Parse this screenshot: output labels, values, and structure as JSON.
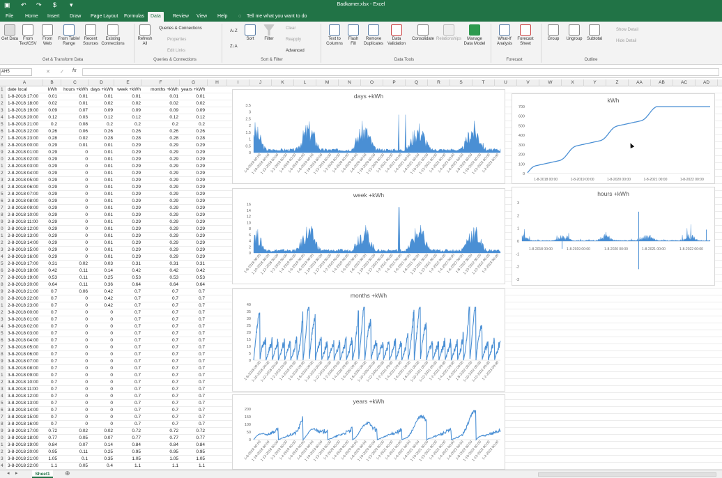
{
  "window": {
    "title": "Badkamer.xlsx  -  Excel"
  },
  "tabs": [
    "File",
    "Home",
    "Insert",
    "Draw",
    "Page Layout",
    "Formulas",
    "Data",
    "Review",
    "View",
    "Help"
  ],
  "tellme": "Tell me what you want to do",
  "ribbon": {
    "get_data": "Get Data",
    "from_text": "From Text/CSV",
    "from_web": "From Web",
    "from_table": "From Table/ Range",
    "recent": "Recent Sources",
    "existing": "Existing Connections",
    "group_get": "Get & Transform Data",
    "refresh": "Refresh All",
    "queries": "Queries & Connections",
    "properties": "Properties",
    "edit_links": "Edit Links",
    "group_queries": "Queries & Connections",
    "sort_az": "A↓Z",
    "sort_za": "Z↓A",
    "sort": "Sort",
    "filter": "Filter",
    "clear": "Clear",
    "reapply": "Reapply",
    "advanced": "Advanced",
    "group_sort": "Sort & Filter",
    "text_cols": "Text to Columns",
    "flash": "Flash Fill",
    "remove_dup": "Remove Duplicates",
    "validation": "Data Validation",
    "consolidate": "Consolidate",
    "relationships": "Relationships",
    "manage_model": "Manage Data Model",
    "group_tools": "Data Tools",
    "whatif": "What-If Analysis",
    "forecast_sheet": "Forecast Sheet",
    "group_forecast": "Forecast",
    "group_btn": "Group",
    "ungroup": "Ungroup",
    "subtotal": "Subtotal",
    "show_detail": "Show Detail",
    "hide_detail": "Hide Detail",
    "group_outline": "Outline"
  },
  "formula": {
    "namebox": "AH5",
    "fx": "fx",
    "cancel": "✕",
    "enter": "✓"
  },
  "columns": [
    "A",
    "B",
    "C",
    "D",
    "E",
    "F",
    "G",
    "H",
    "I",
    "J",
    "K",
    "L",
    "M",
    "N",
    "O",
    "P",
    "Q",
    "R",
    "S",
    "T",
    "U",
    "V",
    "W",
    "X",
    "Y",
    "Z",
    "AA",
    "AB",
    "AC",
    "AD"
  ],
  "headers": [
    "date local",
    "kWh",
    "hours +kWh",
    "days +kWh",
    "week +kWh",
    "months +kWh",
    "years +kWh"
  ],
  "rows": [
    [
      "1",
      "1-8-2018 17:00",
      "0.01",
      "0.01",
      "0.01",
      "0.01",
      "0.01",
      "0.01"
    ],
    [
      "2",
      "1-8-2018 18:00",
      "0.02",
      "0.01",
      "0.02",
      "0.02",
      "0.02",
      "0.02"
    ],
    [
      "3",
      "1-8-2018 19:00",
      "0.09",
      "0.07",
      "0.09",
      "0.09",
      "0.09",
      "0.09"
    ],
    [
      "4",
      "1-8-2018 20:00",
      "0.12",
      "0.03",
      "0.12",
      "0.12",
      "0.12",
      "0.12"
    ],
    [
      "5",
      "1-8-2018 21:00",
      "0.2",
      "0.08",
      "0.2",
      "0.2",
      "0.2",
      "0.2"
    ],
    [
      "6",
      "1-8-2018 22:00",
      "0.26",
      "0.06",
      "0.26",
      "0.26",
      "0.26",
      "0.26"
    ],
    [
      "7",
      "1-8-2018 23:00",
      "0.28",
      "0.02",
      "0.28",
      "0.28",
      "0.28",
      "0.28"
    ],
    [
      "8",
      "2-8-2018 00:00",
      "0.29",
      "0.01",
      "0.01",
      "0.29",
      "0.29",
      "0.29"
    ],
    [
      "9",
      "2-8-2018 01:00",
      "0.29",
      "0",
      "0.01",
      "0.29",
      "0.29",
      "0.29"
    ],
    [
      "0",
      "2-8-2018 02:00",
      "0.29",
      "0",
      "0.01",
      "0.29",
      "0.29",
      "0.29"
    ],
    [
      "1",
      "2-8-2018 03:00",
      "0.29",
      "0",
      "0.01",
      "0.29",
      "0.29",
      "0.29"
    ],
    [
      "2",
      "2-8-2018 04:00",
      "0.29",
      "0",
      "0.01",
      "0.29",
      "0.29",
      "0.29"
    ],
    [
      "3",
      "2-8-2018 05:00",
      "0.29",
      "0",
      "0.01",
      "0.29",
      "0.29",
      "0.29"
    ],
    [
      "4",
      "2-8-2018 06:00",
      "0.29",
      "0",
      "0.01",
      "0.29",
      "0.29",
      "0.29"
    ],
    [
      "5",
      "2-8-2018 07:00",
      "0.29",
      "0",
      "0.01",
      "0.29",
      "0.29",
      "0.29"
    ],
    [
      "6",
      "2-8-2018 08:00",
      "0.29",
      "0",
      "0.01",
      "0.29",
      "0.29",
      "0.29"
    ],
    [
      "7",
      "2-8-2018 09:00",
      "0.29",
      "0",
      "0.01",
      "0.29",
      "0.29",
      "0.29"
    ],
    [
      "8",
      "2-8-2018 10:00",
      "0.29",
      "0",
      "0.01",
      "0.29",
      "0.29",
      "0.29"
    ],
    [
      "9",
      "2-8-2018 11:00",
      "0.29",
      "0",
      "0.01",
      "0.29",
      "0.29",
      "0.29"
    ],
    [
      "0",
      "2-8-2018 12:00",
      "0.29",
      "0",
      "0.01",
      "0.29",
      "0.29",
      "0.29"
    ],
    [
      "1",
      "2-8-2018 13:00",
      "0.29",
      "0",
      "0.01",
      "0.29",
      "0.29",
      "0.29"
    ],
    [
      "2",
      "2-8-2018 14:00",
      "0.29",
      "0",
      "0.01",
      "0.29",
      "0.29",
      "0.29"
    ],
    [
      "3",
      "2-8-2018 15:00",
      "0.29",
      "0",
      "0.01",
      "0.29",
      "0.29",
      "0.29"
    ],
    [
      "4",
      "2-8-2018 16:00",
      "0.29",
      "0",
      "0.01",
      "0.29",
      "0.29",
      "0.29"
    ],
    [
      "5",
      "2-8-2018 17:00",
      "0.31",
      "0.02",
      "0.03",
      "0.31",
      "0.31",
      "0.31"
    ],
    [
      "6",
      "2-8-2018 18:00",
      "0.42",
      "0.11",
      "0.14",
      "0.42",
      "0.42",
      "0.42"
    ],
    [
      "7",
      "2-8-2018 19:00",
      "0.53",
      "0.11",
      "0.25",
      "0.53",
      "0.53",
      "0.53"
    ],
    [
      "8",
      "2-8-2018 20:00",
      "0.64",
      "0.11",
      "0.36",
      "0.64",
      "0.64",
      "0.64"
    ],
    [
      "9",
      "2-8-2018 21:00",
      "0.7",
      "0.06",
      "0.42",
      "0.7",
      "0.7",
      "0.7"
    ],
    [
      "0",
      "2-8-2018 22:00",
      "0.7",
      "0",
      "0.42",
      "0.7",
      "0.7",
      "0.7"
    ],
    [
      "1",
      "2-8-2018 23:00",
      "0.7",
      "0",
      "0.42",
      "0.7",
      "0.7",
      "0.7"
    ],
    [
      "2",
      "3-8-2018 00:00",
      "0.7",
      "0",
      "0",
      "0.7",
      "0.7",
      "0.7"
    ],
    [
      "3",
      "3-8-2018 01:00",
      "0.7",
      "0",
      "0",
      "0.7",
      "0.7",
      "0.7"
    ],
    [
      "4",
      "3-8-2018 02:00",
      "0.7",
      "0",
      "0",
      "0.7",
      "0.7",
      "0.7"
    ],
    [
      "5",
      "3-8-2018 03:00",
      "0.7",
      "0",
      "0",
      "0.7",
      "0.7",
      "0.7"
    ],
    [
      "6",
      "3-8-2018 04:00",
      "0.7",
      "0",
      "0",
      "0.7",
      "0.7",
      "0.7"
    ],
    [
      "7",
      "3-8-2018 05:00",
      "0.7",
      "0",
      "0",
      "0.7",
      "0.7",
      "0.7"
    ],
    [
      "8",
      "3-8-2018 06:00",
      "0.7",
      "0",
      "0",
      "0.7",
      "0.7",
      "0.7"
    ],
    [
      "9",
      "3-8-2018 07:00",
      "0.7",
      "0",
      "0",
      "0.7",
      "0.7",
      "0.7"
    ],
    [
      "0",
      "3-8-2018 08:00",
      "0.7",
      "0",
      "0",
      "0.7",
      "0.7",
      "0.7"
    ],
    [
      "1",
      "3-8-2018 09:00",
      "0.7",
      "0",
      "0",
      "0.7",
      "0.7",
      "0.7"
    ],
    [
      "2",
      "3-8-2018 10:00",
      "0.7",
      "0",
      "0",
      "0.7",
      "0.7",
      "0.7"
    ],
    [
      "3",
      "3-8-2018 11:00",
      "0.7",
      "0",
      "0",
      "0.7",
      "0.7",
      "0.7"
    ],
    [
      "4",
      "3-8-2018 12:00",
      "0.7",
      "0",
      "0",
      "0.7",
      "0.7",
      "0.7"
    ],
    [
      "5",
      "3-8-2018 13:00",
      "0.7",
      "0",
      "0",
      "0.7",
      "0.7",
      "0.7"
    ],
    [
      "6",
      "3-8-2018 14:00",
      "0.7",
      "0",
      "0",
      "0.7",
      "0.7",
      "0.7"
    ],
    [
      "7",
      "3-8-2018 15:00",
      "0.7",
      "0",
      "0",
      "0.7",
      "0.7",
      "0.7"
    ],
    [
      "8",
      "3-8-2018 16:00",
      "0.7",
      "0",
      "0",
      "0.7",
      "0.7",
      "0.7"
    ],
    [
      "9",
      "3-8-2018 17:00",
      "0.72",
      "0.02",
      "0.02",
      "0.72",
      "0.72",
      "0.72"
    ],
    [
      "0",
      "3-8-2018 18:00",
      "0.77",
      "0.05",
      "0.07",
      "0.77",
      "0.77",
      "0.77"
    ],
    [
      "1",
      "3-8-2018 19:00",
      "0.84",
      "0.07",
      "0.14",
      "0.84",
      "0.84",
      "0.84"
    ],
    [
      "2",
      "3-8-2018 20:00",
      "0.95",
      "0.11",
      "0.25",
      "0.95",
      "0.95",
      "0.95"
    ],
    [
      "3",
      "3-8-2018 21:00",
      "1.05",
      "0.1",
      "0.35",
      "1.05",
      "1.05",
      "1.05"
    ],
    [
      "4",
      "3-8-2018 22:00",
      "1.1",
      "0.05",
      "0.4",
      "1.1",
      "1.1",
      "1.1"
    ]
  ],
  "sheet_tab": "Sheet1",
  "colors": {
    "accent": "#217346",
    "series": "#4a8fd4"
  },
  "chart_data": [
    {
      "type": "bar",
      "title": "days +kWh",
      "ylim": [
        0,
        3.5
      ],
      "yticks": [
        "0",
        "0.5",
        "1",
        "1.5",
        "2",
        "2.5",
        "3",
        "3.5"
      ]
    },
    {
      "type": "bar",
      "title": "week +kWh",
      "ylim": [
        0,
        16
      ],
      "yticks": [
        "0",
        "2",
        "4",
        "6",
        "8",
        "10",
        "12",
        "14",
        "16"
      ]
    },
    {
      "type": "line",
      "title": "months +kWh",
      "ylim": [
        0,
        40
      ],
      "yticks": [
        "0",
        "5",
        "10",
        "15",
        "20",
        "25",
        "30",
        "35",
        "40"
      ]
    },
    {
      "type": "line",
      "title": "years +kWh",
      "ylim": [
        0,
        200
      ],
      "yticks": [
        "0",
        "50",
        "100",
        "150",
        "200"
      ]
    },
    {
      "type": "line",
      "title": "kWh",
      "ylim": [
        0,
        700
      ],
      "yticks": [
        "0",
        "100",
        "200",
        "300",
        "400",
        "500",
        "600",
        "700"
      ],
      "xticks": [
        "1-8-2018 00:00",
        "1-8-2019 00:00",
        "1-8-2020 00:00",
        "1-8-2021 00:00",
        "1-8-2022 00:00"
      ]
    },
    {
      "type": "bar",
      "title": "hours +kWh",
      "ylim": [
        -3,
        3
      ],
      "yticks": [
        "-3",
        "-2",
        "-1",
        "0",
        "1",
        "2",
        "3"
      ],
      "xticks": [
        "1-8-2018 00:00",
        "1-8-2019 00:00",
        "1-8-2020 00:00",
        "1-8-2021 00:00",
        "1-8-2022 00:00"
      ]
    }
  ],
  "date_xticks": [
    "1-8-2018 00:00",
    "1-10-2018 00:00",
    "1-12-2018 00:00",
    "1-2-2019 00:00",
    "1-4-2019 00:00",
    "1-6-2019 00:00",
    "1-8-2019 00:00",
    "1-10-2019 00:00",
    "1-12-2019 00:00",
    "1-2-2020 00:00",
    "1-4-2020 00:00",
    "1-6-2020 00:00",
    "1-8-2020 00:00",
    "1-10-2020 00:00",
    "1-12-2020 00:00",
    "1-2-2021 00:00",
    "1-4-2021 00:00",
    "1-6-2021 00:00",
    "1-8-2021 00:00",
    "1-10-2021 00:00",
    "1-12-2021 00:00",
    "1-2-2022 00:00",
    "1-4-2022 00:00",
    "1-6-2022 00:00",
    "1-8-2022 00:00",
    "1-10-2022 00:00",
    "1-12-2022 00:00",
    "1-2-2023 00:00"
  ]
}
